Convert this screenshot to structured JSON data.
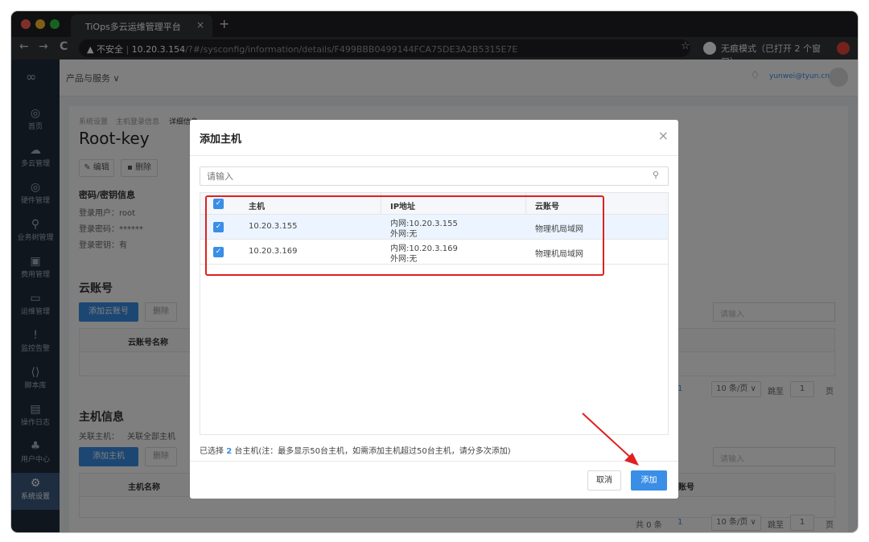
{
  "browser": {
    "tab_title": "TiOps多云运维管理平台",
    "tab_close": "×",
    "new_tab": "+",
    "back": "←",
    "forward": "→",
    "reload": "C",
    "insecure_label": "▲ 不安全",
    "url_host": "10.20.3.154",
    "url_path": "/?#/sysconfig/information/details/F499BBB0499144FCA75DE3A2B5315E7E",
    "star": "☆",
    "incognito_label": "无痕模式（已打开 2 个窗口）"
  },
  "sidebar": {
    "items": [
      {
        "label": "首页",
        "icon": "◎"
      },
      {
        "label": "多云管理",
        "icon": "☁"
      },
      {
        "label": "硬件管理",
        "icon": "◎"
      },
      {
        "label": "业务树管理",
        "icon": "⚲"
      },
      {
        "label": "费用管理",
        "icon": "▣"
      },
      {
        "label": "运维管理",
        "icon": "▭"
      },
      {
        "label": "监控告警",
        "icon": "!"
      },
      {
        "label": "脚本库",
        "icon": "⟨⟩"
      },
      {
        "label": "操作日志",
        "icon": "▤"
      },
      {
        "label": "用户中心",
        "icon": "♣"
      },
      {
        "label": "系统设置",
        "icon": "⚙"
      }
    ]
  },
  "topbar": {
    "menu_label": "产品与服务 ∨",
    "user_email": "yunwei@tyun.cn"
  },
  "page": {
    "breadcrumb": [
      "系统设置",
      "主机登录信息",
      "详细信息"
    ],
    "title": "Root-key",
    "edit_label": "✎ 编辑",
    "delete_label": "▪ 删除",
    "cred_section": "密码/密钥信息",
    "login_user": "登录用户：root",
    "login_password": "登录密码：******",
    "login_key": "登录密钥：有",
    "cloud_section": "云账号",
    "add_cloud_btn": "添加云账号",
    "remove_btn": "删除",
    "search_placeholder": "请输入",
    "cloud_col": "云账号名称",
    "host_section": "主机信息",
    "assoc_label": "关联主机：",
    "assoc_all": "关联全部主机",
    "add_host_btn": "添加主机",
    "host_col": "主机名称",
    "acct_col": "账号",
    "pager_page": "1",
    "page_size": "10 条/页 ∨",
    "goto_label": "跳至",
    "page_unit": "页",
    "total_label": "共 0 条"
  },
  "modal": {
    "title": "添加主机",
    "close": "×",
    "search_placeholder": "请输入",
    "search_icon": "⚲",
    "columns": {
      "host": "主机",
      "ip": "IP地址",
      "account": "云账号"
    },
    "rows": [
      {
        "host": "10.20.3.155",
        "ip_inner": "内网:10.20.3.155",
        "ip_outer": "外网:无",
        "account": "物理机局域网"
      },
      {
        "host": "10.20.3.169",
        "ip_inner": "内网:10.20.3.169",
        "ip_outer": "外网:无",
        "account": "物理机局域网"
      }
    ],
    "selected_prefix": "已选择",
    "selected_count": "2",
    "selected_suffix": "台主机(注：最多显示50台主机，如需添加主机超过50台主机，请分多次添加)",
    "cancel_label": "取消",
    "add_label": "添加",
    "checkmark": "✓"
  },
  "colors": {
    "primary": "#3a8ee6",
    "highlight": "#e02020",
    "sidebar": "#1f2d3d"
  }
}
